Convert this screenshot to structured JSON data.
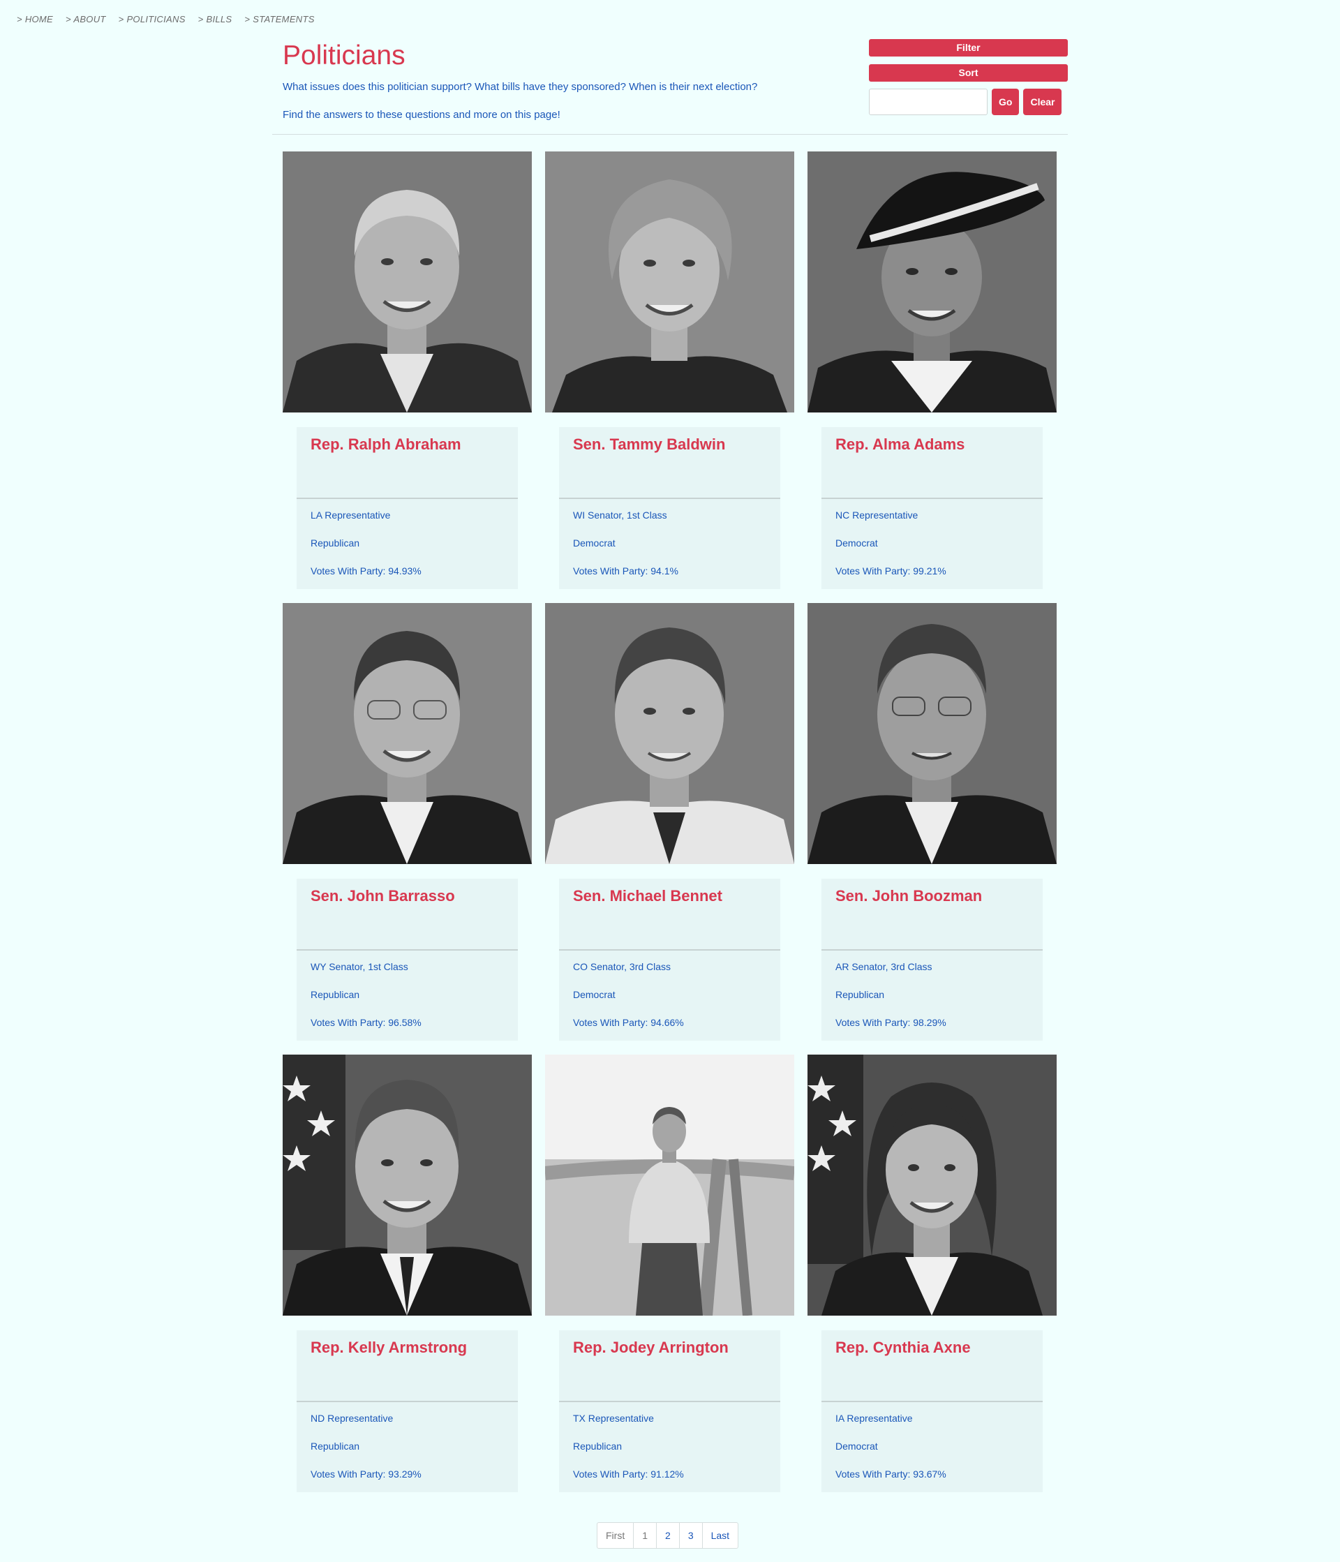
{
  "breadcrumb": [
    "HOME",
    "ABOUT",
    "POLITICIANS",
    "BILLS",
    "STATEMENTS"
  ],
  "header": {
    "title": "Politicians",
    "intro": "What issues does this politician support? What bills have they sponsored? When is their next election?",
    "intro2": "Find the answers to these questions and more on this page!"
  },
  "controls": {
    "filter_label": "Filter",
    "sort_label": "Sort",
    "search_value": "",
    "go_label": "Go",
    "clear_label": "Clear"
  },
  "politicians": [
    {
      "name": "Rep. Ralph Abraham",
      "office": "LA Representative",
      "party": "Republican",
      "votes": "Votes With Party: 94.93%"
    },
    {
      "name": "Sen. Tammy Baldwin",
      "office": "WI Senator, 1st Class",
      "party": "Democrat",
      "votes": "Votes With Party: 94.1%"
    },
    {
      "name": "Rep. Alma Adams",
      "office": "NC Representative",
      "party": "Democrat",
      "votes": "Votes With Party: 99.21%"
    },
    {
      "name": "Sen. John Barrasso",
      "office": "WY Senator, 1st Class",
      "party": "Republican",
      "votes": "Votes With Party: 96.58%"
    },
    {
      "name": "Sen. Michael Bennet",
      "office": "CO Senator, 3rd Class",
      "party": "Democrat",
      "votes": "Votes With Party: 94.66%"
    },
    {
      "name": "Sen. John Boozman",
      "office": "AR Senator, 3rd Class",
      "party": "Republican",
      "votes": "Votes With Party: 98.29%"
    },
    {
      "name": "Rep. Kelly Armstrong",
      "office": "ND Representative",
      "party": "Republican",
      "votes": "Votes With Party: 93.29%"
    },
    {
      "name": "Rep. Jodey Arrington",
      "office": "TX Representative",
      "party": "Republican",
      "votes": "Votes With Party: 91.12%"
    },
    {
      "name": "Rep. Cynthia Axne",
      "office": "IA Representative",
      "party": "Democrat",
      "votes": "Votes With Party: 93.67%"
    }
  ],
  "pagination": [
    "First",
    "1",
    "2",
    "3",
    "Last"
  ],
  "colors": {
    "accent": "#d8384f",
    "link": "#1a56b8",
    "background": "#f0fffe",
    "card": "#e6f5f5"
  }
}
